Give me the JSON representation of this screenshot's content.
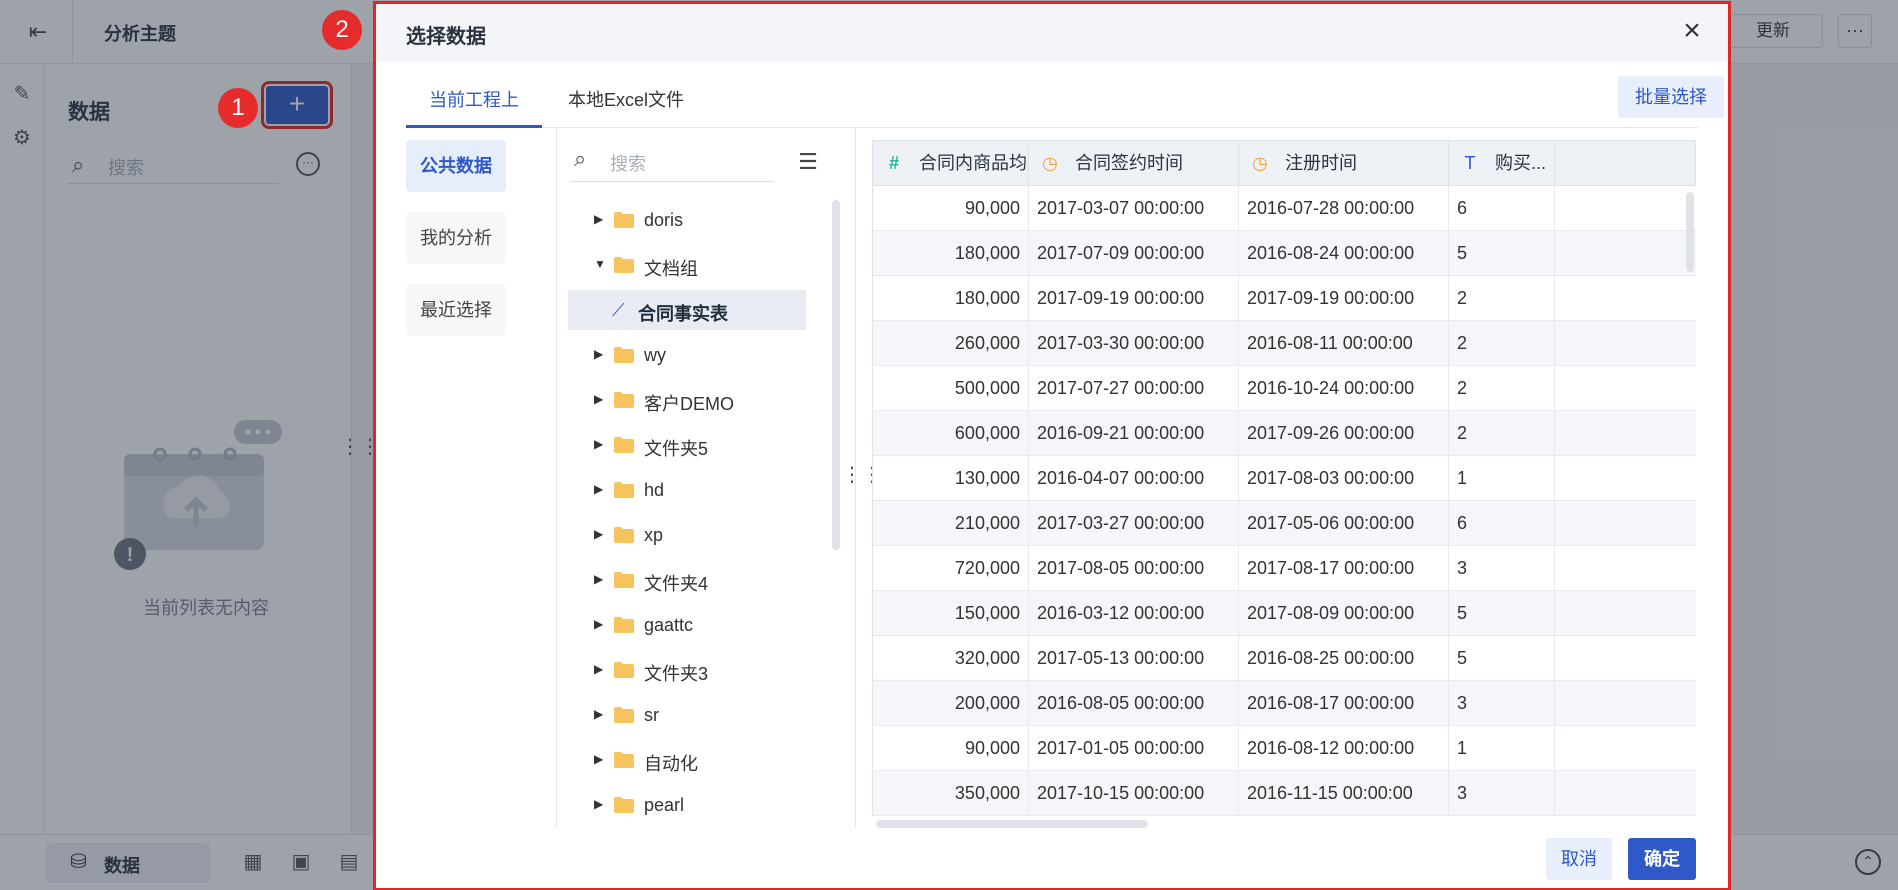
{
  "app": {
    "title": "分析主题",
    "update_label": "更新",
    "more_label": "···",
    "side_title": "数据",
    "add_label": "+",
    "search_placeholder": "搜索",
    "empty_text": "当前列表无内容",
    "bottom_tab_label": "数据"
  },
  "markers": {
    "m1": "1",
    "m2": "2"
  },
  "dialog": {
    "title": "选择数据",
    "close_label": "×",
    "tabs": [
      {
        "label": "当前工程上"
      },
      {
        "label": "本地Excel文件"
      }
    ],
    "batch_label": "批量选择",
    "categories": [
      {
        "label": "公共数据"
      },
      {
        "label": "我的分析"
      },
      {
        "label": "最近选择"
      }
    ],
    "tree_search_placeholder": "搜索",
    "tree": [
      {
        "label": "doris",
        "expanded": false
      },
      {
        "label": "文档组",
        "expanded": true
      },
      {
        "label": "合同事实表",
        "selected": true
      },
      {
        "label": "wy",
        "expanded": false
      },
      {
        "label": "客户DEMO",
        "expanded": false
      },
      {
        "label": "文件夹5",
        "expanded": false
      },
      {
        "label": "hd",
        "expanded": false
      },
      {
        "label": "xp",
        "expanded": false
      },
      {
        "label": "文件夹4",
        "expanded": false
      },
      {
        "label": "gaattc",
        "expanded": false
      },
      {
        "label": "文件夹3",
        "expanded": false
      },
      {
        "label": "sr",
        "expanded": false
      },
      {
        "label": "自动化",
        "expanded": false
      },
      {
        "label": "pearl",
        "expanded": false
      }
    ],
    "table": {
      "columns": [
        {
          "type_icon": "#",
          "label": "合同内商品均价"
        },
        {
          "type_icon": "clock",
          "label": "合同签约时间"
        },
        {
          "type_icon": "clock",
          "label": "注册时间"
        },
        {
          "type_icon": "T",
          "label": "购买..."
        }
      ],
      "rows": [
        [
          "90,000",
          "2017-03-07 00:00:00",
          "2016-07-28 00:00:00",
          "6"
        ],
        [
          "180,000",
          "2017-07-09 00:00:00",
          "2016-08-24 00:00:00",
          "5"
        ],
        [
          "180,000",
          "2017-09-19 00:00:00",
          "2017-09-19 00:00:00",
          "2"
        ],
        [
          "260,000",
          "2017-03-30 00:00:00",
          "2016-08-11 00:00:00",
          "2"
        ],
        [
          "500,000",
          "2017-07-27 00:00:00",
          "2016-10-24 00:00:00",
          "2"
        ],
        [
          "600,000",
          "2016-09-21 00:00:00",
          "2017-09-26 00:00:00",
          "2"
        ],
        [
          "130,000",
          "2016-04-07 00:00:00",
          "2017-08-03 00:00:00",
          "1"
        ],
        [
          "210,000",
          "2017-03-27 00:00:00",
          "2017-05-06 00:00:00",
          "6"
        ],
        [
          "720,000",
          "2017-08-05 00:00:00",
          "2017-08-17 00:00:00",
          "3"
        ],
        [
          "150,000",
          "2016-03-12 00:00:00",
          "2017-08-09 00:00:00",
          "5"
        ],
        [
          "320,000",
          "2017-05-13 00:00:00",
          "2016-08-25 00:00:00",
          "5"
        ],
        [
          "200,000",
          "2016-08-05 00:00:00",
          "2016-08-17 00:00:00",
          "3"
        ],
        [
          "90,000",
          "2017-01-05 00:00:00",
          "2016-08-12 00:00:00",
          "1"
        ],
        [
          "350,000",
          "2017-10-15 00:00:00",
          "2016-11-15 00:00:00",
          "3"
        ]
      ]
    },
    "cancel_label": "取消",
    "ok_label": "确定"
  },
  "colors": {
    "accent": "#2f58c8",
    "highlight_red": "#e02626",
    "number_icon": "#2bb39b",
    "time_icon": "#f0a13a",
    "folder": "#f7c35c"
  }
}
